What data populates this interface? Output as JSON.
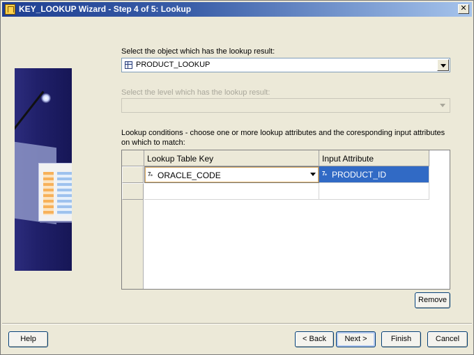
{
  "window": {
    "title": "KEY_LOOKUP Wizard - Step 4 of 5: Lookup",
    "close_glyph": "✕"
  },
  "object_section": {
    "label": "Select the object which has the lookup result:",
    "selected_value": "PRODUCT_LOOKUP",
    "icon": "table-icon"
  },
  "level_section": {
    "label": "Select the level which has the lookup result:",
    "selected_value": "",
    "disabled": true
  },
  "conditions": {
    "instruction": "Lookup conditions - choose one or more lookup attributes and the coresponding input attributes on which to match:",
    "columns": [
      "Lookup Table Key",
      "Input Attribute"
    ],
    "rows": [
      {
        "lookup_key": "ORACLE_CODE",
        "lookup_type": "7₉",
        "input_attribute": "PRODUCT_ID",
        "input_type": "7₉"
      },
      {
        "lookup_key": "",
        "input_attribute": ""
      }
    ]
  },
  "buttons": {
    "remove": "Remove",
    "help": "Help",
    "back": "< Back",
    "next": "Next >",
    "finish": "Finish",
    "cancel": "Cancel"
  },
  "colors": {
    "selection": "#316ac5",
    "title_start": "#1f3f92",
    "dialog_bg": "#ece9d8"
  }
}
